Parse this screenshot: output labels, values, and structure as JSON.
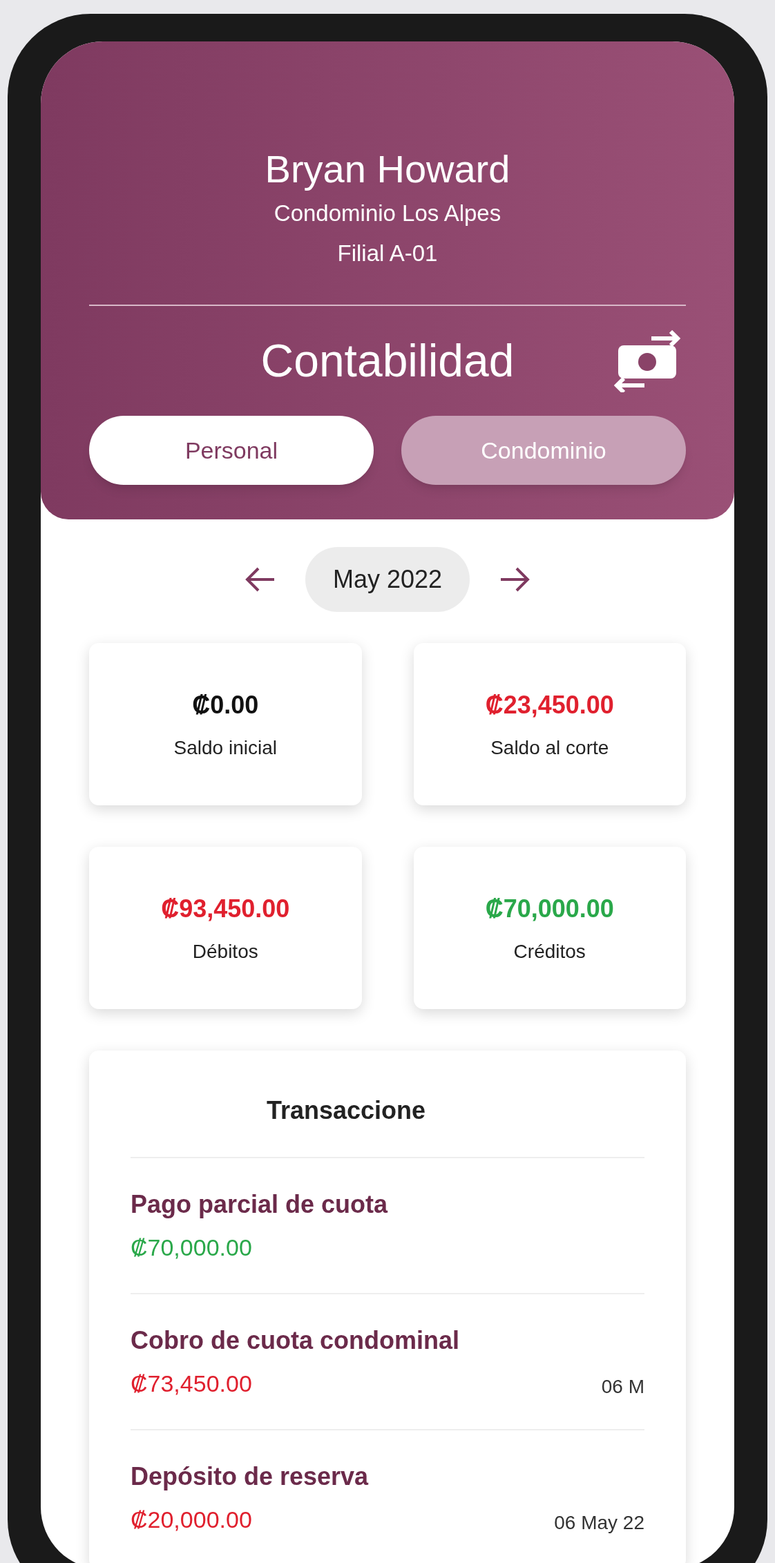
{
  "header": {
    "name": "Bryan Howard",
    "condo": "Condominio Los Alpes",
    "unit": "Filial A-01",
    "title": "Contabilidad"
  },
  "tabs": [
    {
      "label": "Personal",
      "selected": true
    },
    {
      "label": "Condominio",
      "selected": false
    }
  ],
  "month": "May 2022",
  "summary": [
    {
      "amount": "₡0.00",
      "label": "Saldo inicial",
      "color": "#111111"
    },
    {
      "amount": "₡23,450.00",
      "label": "Saldo al corte",
      "color": "#e0202e"
    },
    {
      "amount": "₡93,450.00",
      "label": "Débitos",
      "color": "#e0202e"
    },
    {
      "amount": "₡70,000.00",
      "label": "Créditos",
      "color": "#2aa84a"
    }
  ],
  "transactions": {
    "title": "Transaccione",
    "items": [
      {
        "name": "Pago parcial de cuota",
        "amount": "₡70,000.00",
        "color": "#2aa84a"
      },
      {
        "name": "Cobro de cuota condominal",
        "amount": "₡73,450.00",
        "date": "06 M",
        "color": "#e0202e"
      },
      {
        "name": "Depósito de reserva",
        "amount": "₡20,000.00",
        "date": "06 May 22",
        "color": "#e0202e"
      }
    ]
  }
}
